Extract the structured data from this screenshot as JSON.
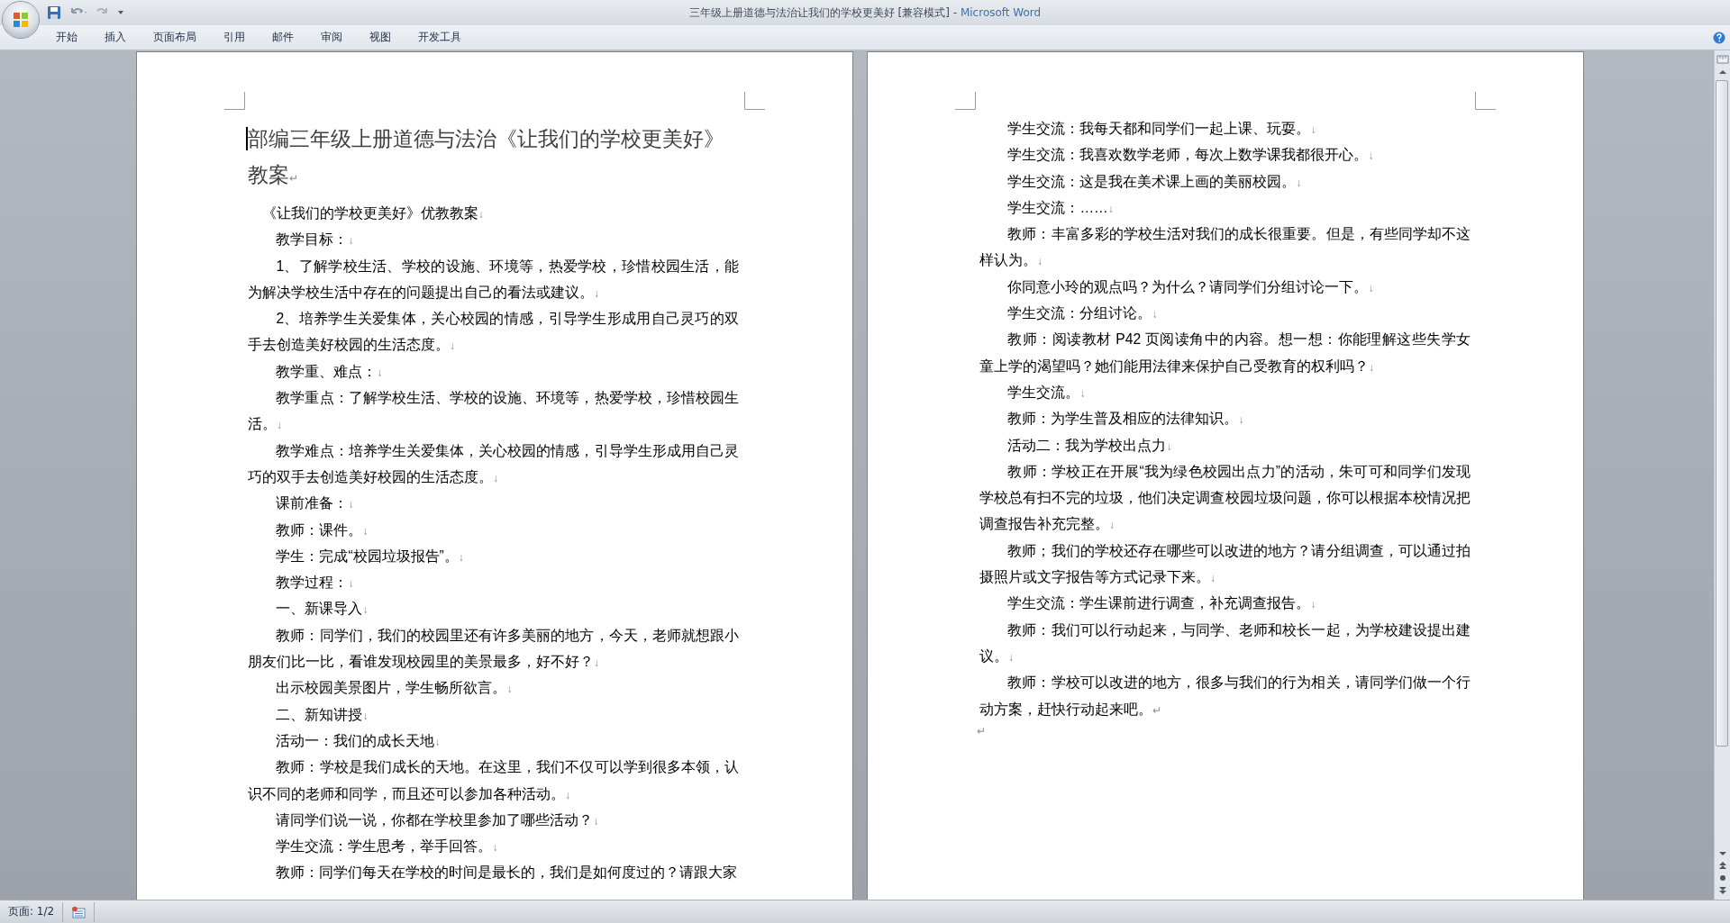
{
  "window": {
    "title": "三年级上册道德与法治让我们的学校更美好 [兼容模式] -",
    "app_name": "Microsoft Word"
  },
  "tabs": [
    {
      "label": "开始",
      "selected": false
    },
    {
      "label": "插入",
      "selected": false
    },
    {
      "label": "页面布局",
      "selected": false
    },
    {
      "label": "引用",
      "selected": false
    },
    {
      "label": "邮件",
      "selected": false
    },
    {
      "label": "审阅",
      "selected": false
    },
    {
      "label": "视图",
      "selected": false
    },
    {
      "label": "开发工具",
      "selected": false
    }
  ],
  "pages": [
    {
      "paragraphs": [
        {
          "kind": "title",
          "text": "部编三年级上册道德与法治《让我们的学校更美好》教案",
          "mark": "↵",
          "cursor": true
        },
        {
          "kind": "subtitle",
          "text": "《让我们的学校更美好》优教教案",
          "mark": "↓"
        },
        {
          "kind": "body",
          "text": "教学目标：",
          "mark": "↓"
        },
        {
          "kind": "body",
          "text": "1、了解学校生活、学校的设施、环境等，热爱学校，珍惜校园生活，能为解决学校生活中存在的问题提出自己的看法或建议。",
          "mark": "↓"
        },
        {
          "kind": "body",
          "text": "2、培养学生关爱集体，关心校园的情感，引导学生形成用自己灵巧的双手去创造美好校园的生活态度。",
          "mark": "↓"
        },
        {
          "kind": "body",
          "text": "教学重、难点：",
          "mark": "↓"
        },
        {
          "kind": "body",
          "text": "教学重点：了解学校生活、学校的设施、环境等，热爱学校，珍惜校园生活。",
          "mark": "↓"
        },
        {
          "kind": "body",
          "text": "教学难点：培养学生关爱集体，关心校园的情感，引导学生形成用自己灵巧的双手去创造美好校园的生活态度。",
          "mark": "↓"
        },
        {
          "kind": "body",
          "text": "课前准备：",
          "mark": "↓"
        },
        {
          "kind": "body",
          "text": "教师：课件。",
          "mark": "↓"
        },
        {
          "kind": "body",
          "text": "学生：完成“校园垃圾报告”。",
          "mark": "↓"
        },
        {
          "kind": "body",
          "text": "教学过程：",
          "mark": "↓"
        },
        {
          "kind": "body",
          "text": "一、新课导入",
          "mark": "↓"
        },
        {
          "kind": "body",
          "text": "教师：同学们，我们的校园里还有许多美丽的地方，今天，老师就想跟小朋友们比一比，看谁发现校园里的美景最多，好不好？",
          "mark": "↓"
        },
        {
          "kind": "body",
          "text": "出示校园美景图片，学生畅所欲言。",
          "mark": "↓"
        },
        {
          "kind": "body",
          "text": "二、新知讲授",
          "mark": "↓"
        },
        {
          "kind": "body",
          "text": "活动一：我们的成长天地",
          "mark": "↓"
        },
        {
          "kind": "body",
          "text": "教师：学校是我们成长的天地。在这里，我们不仅可以学到很多本领，认识不同的老师和同学，而且还可以参加各种活动。",
          "mark": "↓"
        },
        {
          "kind": "body",
          "text": "请同学们说一说，你都在学校里参加了哪些活动？",
          "mark": "↓"
        },
        {
          "kind": "body",
          "text": "学生交流：学生思考，举手回答。",
          "mark": "↓"
        },
        {
          "kind": "body",
          "text": "教师：同学们每天在学校的时间是最长的，我们是如何度过的？请跟大家"
        }
      ]
    },
    {
      "paragraphs": [
        {
          "kind": "body",
          "text": "学生交流：我每天都和同学们一起上课、玩耍。",
          "mark": "↓"
        },
        {
          "kind": "body",
          "text": "学生交流：我喜欢数学老师，每次上数学课我都很开心。",
          "mark": "↓"
        },
        {
          "kind": "body",
          "text": "学生交流：这是我在美术课上画的美丽校园。",
          "mark": "↓"
        },
        {
          "kind": "body",
          "text": "学生交流：……",
          "mark": "↓"
        },
        {
          "kind": "body",
          "text": "教师：丰富多彩的学校生活对我们的成长很重要。但是，有些同学却不这样认为。",
          "mark": "↓"
        },
        {
          "kind": "body",
          "text": "你同意小玲的观点吗？为什么？请同学们分组讨论一下。",
          "mark": "↓"
        },
        {
          "kind": "body",
          "text": "学生交流：分组讨论。",
          "mark": "↓"
        },
        {
          "kind": "body",
          "text": "教师：阅读教材 P42 页阅读角中的内容。想一想：你能理解这些失学女童上学的渴望吗？她们能用法律来保护自己受教育的权利吗？",
          "mark": "↓"
        },
        {
          "kind": "body",
          "text": "学生交流。",
          "mark": "↓"
        },
        {
          "kind": "body",
          "text": "教师：为学生普及相应的法律知识。",
          "mark": "↓"
        },
        {
          "kind": "body",
          "text": "活动二：我为学校出点力",
          "mark": "↓"
        },
        {
          "kind": "body",
          "text": "教师：学校正在开展“我为绿色校园出点力”的活动，朱可可和同学们发现学校总有扫不完的垃圾，他们决定调查校园垃圾问题，你可以根据本校情况把调查报告补充完整。",
          "mark": "↓"
        },
        {
          "kind": "body",
          "text": "教师；我们的学校还存在哪些可以改进的地方？请分组调查，可以通过拍摄照片或文字报告等方式记录下来。",
          "mark": "↓"
        },
        {
          "kind": "body",
          "text": "学生交流：学生课前进行调查，补充调查报告。",
          "mark": "↓"
        },
        {
          "kind": "body",
          "text": "教师：我们可以行动起来，与同学、老师和校长一起，为学校建设提出建议。",
          "mark": "↓"
        },
        {
          "kind": "body",
          "text": "教师：学校可以改进的地方，很多与我们的行为相关，请同学们做一个行动方案，赶快行动起来吧。",
          "mark": "↵"
        },
        {
          "kind": "empty",
          "mark": "↵"
        }
      ]
    }
  ],
  "status_bar": {
    "page": "页面: 1/2"
  }
}
